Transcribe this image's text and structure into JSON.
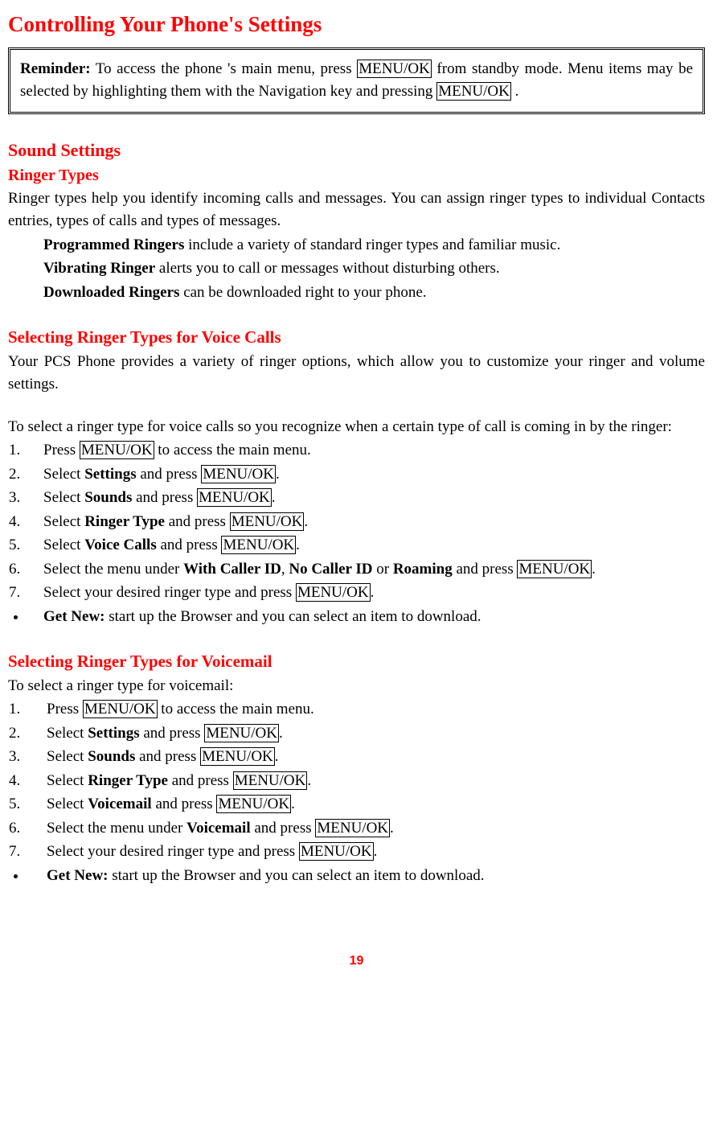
{
  "title": "Controlling Your Phone's Settings",
  "reminder": {
    "label": "Reminder:",
    "pre": " To access the phone 's main menu, press ",
    "key1": "MENU/OK",
    "mid": " from standby mode. Menu items may be selected by highlighting them with the Navigation key and pressing ",
    "key2": "MENU/OK",
    "post": " ."
  },
  "sound_settings": {
    "heading": "Sound Settings",
    "ringer_types": {
      "heading": "Ringer Types",
      "intro": "Ringer types help you identify incoming calls and messages. You can assign ringer types to individual Contacts entries, types of calls and types of messages.",
      "items": [
        {
          "label": "Programmed Ringers",
          "text": " include a variety of standard ringer types and familiar music."
        },
        {
          "label": "Vibrating Ringer",
          "text": " alerts you to call or messages without disturbing others."
        },
        {
          "label": "Downloaded Ringers",
          "text": " can be downloaded right to your phone."
        }
      ]
    },
    "voice_calls": {
      "heading": "Selecting Ringer Types for Voice Calls",
      "intro1": "Your PCS Phone provides a variety of ringer options, which allow you to customize your ringer and volume settings.",
      "intro2": "To select a ringer type for voice calls so you recognize when a certain type of call is coming in by the ringer:",
      "steps": [
        {
          "pre": "Press ",
          "key": "MENU/OK",
          "post": " to access the main menu."
        },
        {
          "pre": "Select ",
          "bold": "Settings",
          "mid": " and press ",
          "key": "MENU/OK",
          "post": "."
        },
        {
          "pre": "Select ",
          "bold": "Sounds",
          "mid": " and press ",
          "key": "MENU/OK",
          "post": "."
        },
        {
          "pre": "Select ",
          "bold": "Ringer Type",
          "mid": " and press ",
          "key": "MENU/OK",
          "post": "."
        },
        {
          "pre": "Select ",
          "bold": "Voice Calls",
          "mid": " and press ",
          "key": "MENU/OK",
          "post": "."
        },
        {
          "pre": "Select the menu under ",
          "bold": "With Caller ID",
          "sep1": ", ",
          "bold2": "No Caller ID",
          "sep2": " or ",
          "bold3": "Roaming",
          "mid": " and press ",
          "key": "MENU/OK",
          "post": "."
        },
        {
          "pre": "Select your desired ringer type and press ",
          "key": "MENU/OK",
          "post": "."
        }
      ],
      "getnew": {
        "label": "Get New:",
        "text": " start up the Browser and you can select an item to download."
      }
    },
    "voicemail": {
      "heading": "Selecting Ringer Types for Voicemail",
      "intro": "To select a ringer type for voicemail:",
      "steps": [
        {
          "pre": "Press ",
          "key": "MENU/OK",
          "post": " to access the main menu."
        },
        {
          "pre": " Select ",
          "bold": "Settings",
          "mid": " and press ",
          "key": "MENU/OK",
          "post": "."
        },
        {
          "pre": " Select ",
          "bold": "Sounds",
          "mid": " and press ",
          "key": "MENU/OK",
          "post": "."
        },
        {
          "pre": " Select ",
          "bold": "Ringer Type",
          "mid": " and press ",
          "key": "MENU/OK",
          "post": "."
        },
        {
          "pre": "Select ",
          "bold": "Voicemail",
          "mid": " and press ",
          "key": "MENU/OK",
          "post": "."
        },
        {
          "pre": "Select the menu under ",
          "bold": "Voicemail",
          "mid": " and press ",
          "key": "MENU/OK",
          "post": "."
        },
        {
          "pre": "Select your desired ringer type and press ",
          "key": "MENU/OK",
          "post": "."
        }
      ],
      "getnew": {
        "label": "Get New:",
        "text": " start up the Browser and you can select an item to download."
      }
    }
  },
  "page_number": "19"
}
